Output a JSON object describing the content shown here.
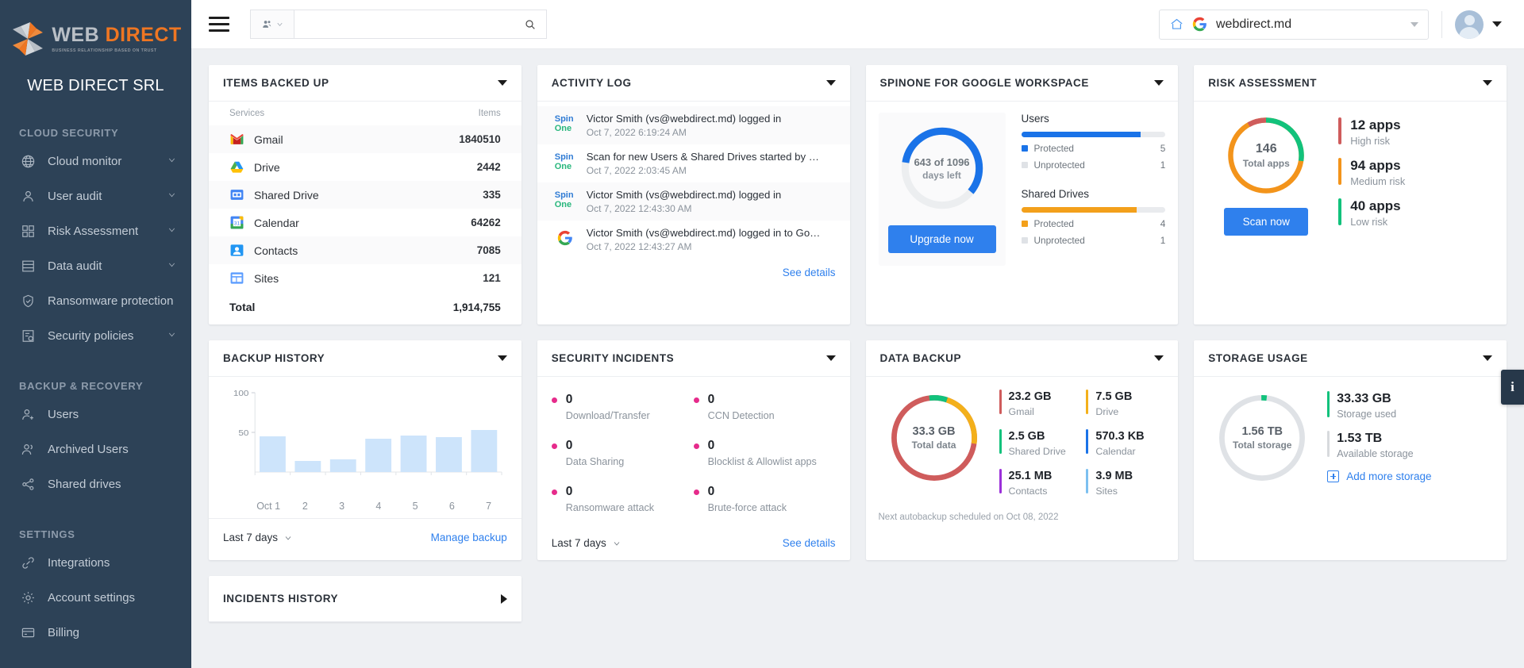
{
  "sidebar": {
    "logo": {
      "word1": "WEB",
      "word2": "DIRECT",
      "tagline": "BUSINESS RELATIONSHIP BASED ON TRUST"
    },
    "org_title": "WEB DIRECT SRL",
    "sections": [
      {
        "label": "CLOUD SECURITY",
        "items": [
          {
            "label": "Cloud monitor",
            "icon": "globe-icon",
            "caret": true
          },
          {
            "label": "User audit",
            "icon": "user-icon",
            "caret": true
          },
          {
            "label": "Risk Assessment",
            "icon": "grid-icon",
            "caret": true
          },
          {
            "label": "Data audit",
            "icon": "list-icon",
            "caret": true
          },
          {
            "label": "Ransomware protection",
            "icon": "shield-icon",
            "caret": false
          },
          {
            "label": "Security policies",
            "icon": "policy-icon",
            "caret": true
          }
        ]
      },
      {
        "label": "BACKUP & RECOVERY",
        "items": [
          {
            "label": "Users",
            "icon": "user-add-icon",
            "caret": false
          },
          {
            "label": "Archived Users",
            "icon": "users-icon",
            "caret": false
          },
          {
            "label": "Shared drives",
            "icon": "share-icon",
            "caret": false
          }
        ]
      },
      {
        "label": "SETTINGS",
        "items": [
          {
            "label": "Integrations",
            "icon": "link-icon",
            "caret": false
          },
          {
            "label": "Account settings",
            "icon": "gear-icon",
            "caret": false
          },
          {
            "label": "Billing",
            "icon": "card-icon",
            "caret": false
          }
        ]
      }
    ]
  },
  "topbar": {
    "menu_icon": "hamburger-icon",
    "search": {
      "value": "",
      "placeholder": "",
      "scope_icon": "users-icon",
      "submit_icon": "search-icon"
    },
    "domain": {
      "value": "webdirect.md",
      "home_icon": "home-icon",
      "provider_icon": "google-icon"
    },
    "account_icon": "avatar"
  },
  "cards": {
    "items_backed_up": {
      "title": "ITEMS BACKED UP",
      "columns": {
        "service": "Services",
        "items": "Items"
      },
      "rows": [
        {
          "name": "Gmail",
          "icon": "gmail-icon",
          "items": "1840510"
        },
        {
          "name": "Drive",
          "icon": "drive-icon",
          "items": "2442"
        },
        {
          "name": "Shared Drive",
          "icon": "shared-drive-icon",
          "items": "335"
        },
        {
          "name": "Calendar",
          "icon": "calendar-icon",
          "items": "64262"
        },
        {
          "name": "Contacts",
          "icon": "contacts-icon",
          "items": "7085"
        },
        {
          "name": "Sites",
          "icon": "sites-icon",
          "items": "121"
        }
      ],
      "total_label": "Total",
      "total_value": "1,914,755"
    },
    "activity_log": {
      "title": "ACTIVITY LOG",
      "entries": [
        {
          "text": "Victor Smith (vs@webdirect.md) logged in",
          "time": "Oct 7, 2022 6:19:24 AM",
          "icon": "spinone-logo"
        },
        {
          "text": "Scan for new Users & Shared Drives started by …",
          "time": "Oct 7, 2022 2:03:45 AM",
          "icon": "spinone-logo"
        },
        {
          "text": "Victor Smith (vs@webdirect.md) logged in",
          "time": "Oct 7, 2022 12:43:30 AM",
          "icon": "spinone-logo"
        },
        {
          "text": "Victor Smith (vs@webdirect.md) logged in to Go…",
          "time": "Oct 7, 2022 12:43:27 AM",
          "icon": "google-icon"
        }
      ],
      "see_details": "See details"
    },
    "spinone_workspace": {
      "title": "SPINONE FOR GOOGLE WORKSPACE",
      "days_text": "643 of 1096",
      "days_sub": "days left",
      "days_used": 643,
      "days_total": 1096,
      "upgrade_label": "Upgrade now",
      "groups": [
        {
          "name": "Users",
          "protected_label": "Protected",
          "protected_value": "5",
          "unprotected_label": "Unprotected",
          "unprotected_value": "1",
          "color": "#1a73e8"
        },
        {
          "name": "Shared Drives",
          "protected_label": "Protected",
          "protected_value": "4",
          "unprotected_label": "Unprotected",
          "unprotected_value": "1",
          "color": "#f3a01b"
        }
      ]
    },
    "risk_assessment": {
      "title": "RISK ASSESSMENT",
      "total": "146",
      "total_label": "Total apps",
      "scan_label": "Scan now",
      "items": [
        {
          "value": "12 apps",
          "label": "High risk",
          "color": "#cf5c5c"
        },
        {
          "value": "94 apps",
          "label": "Medium risk",
          "color": "#f3941b"
        },
        {
          "value": "40 apps",
          "label": "Low risk",
          "color": "#12c27c"
        }
      ]
    },
    "backup_history": {
      "title": "BACKUP HISTORY",
      "range_label": "Last 7 days",
      "manage_label": "Manage backup"
    },
    "security_incidents": {
      "title": "SECURITY INCIDENTS",
      "range_label": "Last 7 days",
      "see_details": "See details",
      "items": [
        {
          "value": "0",
          "label": "Download/Transfer"
        },
        {
          "value": "0",
          "label": "CCN Detection"
        },
        {
          "value": "0",
          "label": "Data Sharing"
        },
        {
          "value": "0",
          "label": "Blocklist & Allowlist apps"
        },
        {
          "value": "0",
          "label": "Ransomware attack"
        },
        {
          "value": "0",
          "label": "Brute-force attack"
        }
      ],
      "dot_color": "#e62b8b"
    },
    "data_backup": {
      "title": "DATA BACKUP",
      "total": "33.3 GB",
      "total_label": "Total data",
      "note": "Next autobackup scheduled on Oct 08, 2022",
      "items": [
        {
          "value": "23.2 GB",
          "label": "Gmail",
          "color": "#cf5c5c"
        },
        {
          "value": "7.5 GB",
          "label": "Drive",
          "color": "#f3b01b"
        },
        {
          "value": "2.5 GB",
          "label": "Shared Drive",
          "color": "#12c27c"
        },
        {
          "value": "570.3 KB",
          "label": "Calendar",
          "color": "#1a73e8"
        },
        {
          "value": "25.1 MB",
          "label": "Contacts",
          "color": "#9b30d9"
        },
        {
          "value": "3.9 MB",
          "label": "Sites",
          "color": "#7cc0f0"
        }
      ]
    },
    "storage_usage": {
      "title": "STORAGE USAGE",
      "total": "1.56 TB",
      "total_label": "Total storage",
      "add_label": "Add more storage",
      "items": [
        {
          "value": "33.33 GB",
          "label": "Storage used",
          "color": "#12c27c"
        },
        {
          "value": "1.53 TB",
          "label": "Available storage",
          "color": "#d7dadd"
        }
      ]
    },
    "incidents_history": {
      "title": "INCIDENTS HISTORY"
    }
  },
  "info_tab": {
    "label": "i"
  },
  "chart_data": {
    "type": "bar",
    "title": "BACKUP HISTORY",
    "categories": [
      "Oct 1",
      "2",
      "3",
      "4",
      "5",
      "6",
      "7"
    ],
    "values": [
      45,
      14,
      16,
      42,
      46,
      44,
      53
    ],
    "ylim": [
      0,
      100
    ],
    "yticks": [
      50,
      100
    ],
    "ytick_labels": [
      "50",
      "100"
    ],
    "xlabel": "",
    "ylabel": "",
    "bar_color": "#cde4fb",
    "grid": false,
    "legend": "none"
  }
}
